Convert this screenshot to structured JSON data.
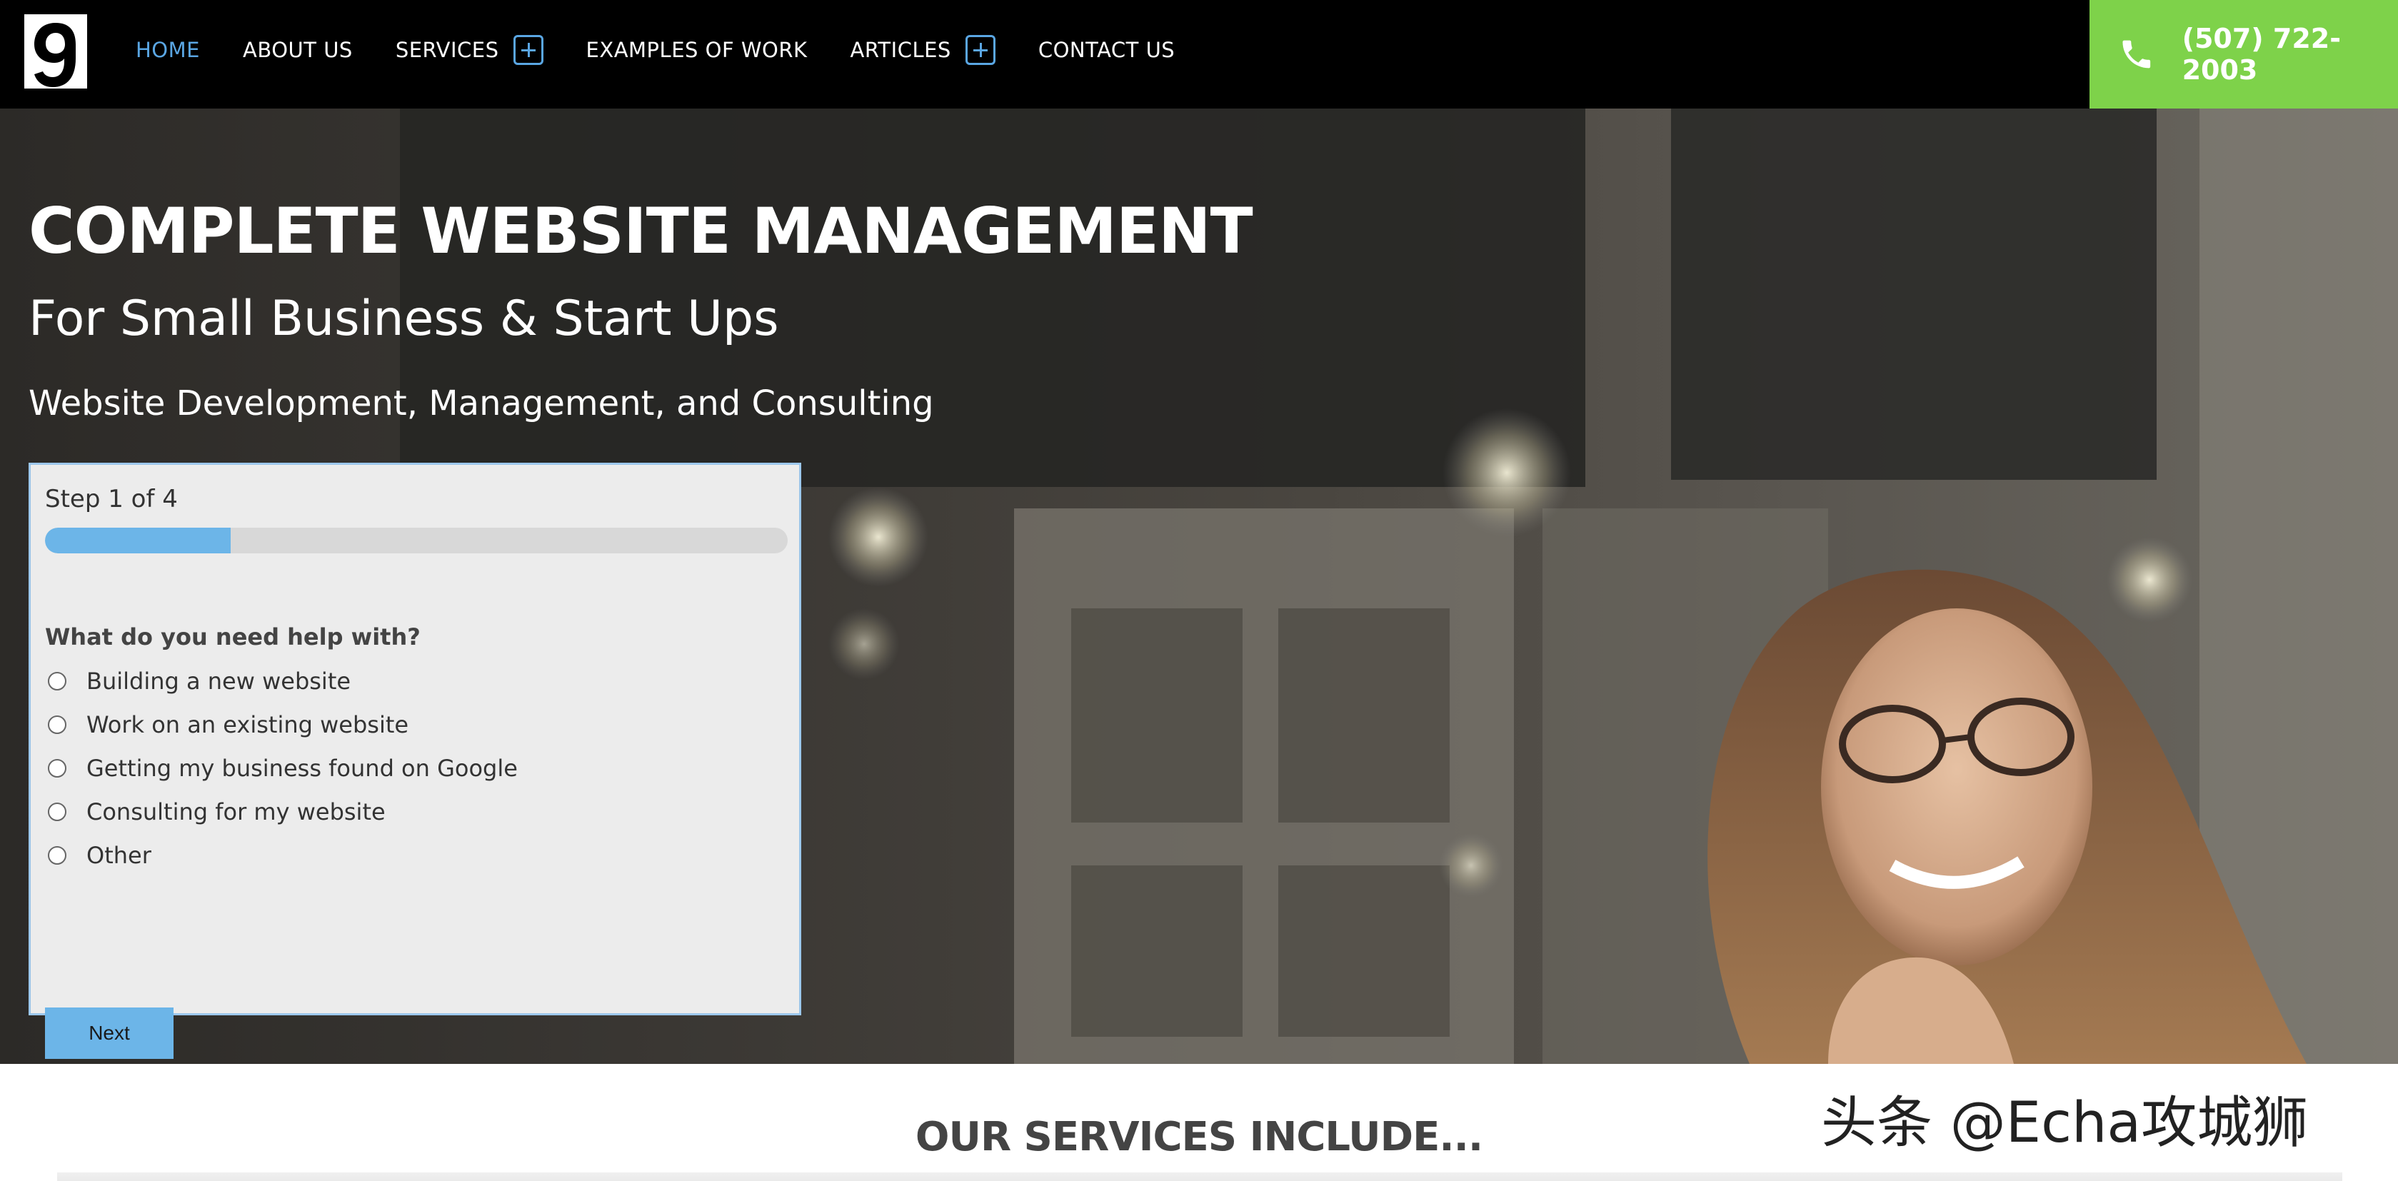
{
  "brand": {
    "logo_icon": "nine-logo-icon"
  },
  "nav": {
    "items": [
      {
        "label": "HOME",
        "active": true,
        "has_submenu": false
      },
      {
        "label": "ABOUT US",
        "active": false,
        "has_submenu": false
      },
      {
        "label": "SERVICES",
        "active": false,
        "has_submenu": true
      },
      {
        "label": "EXAMPLES OF WORK",
        "active": false,
        "has_submenu": false
      },
      {
        "label": "ARTICLES",
        "active": false,
        "has_submenu": true
      },
      {
        "label": "CONTACT US",
        "active": false,
        "has_submenu": false
      }
    ],
    "phone": "(507) 722-2003",
    "phone_icon": "phone-icon"
  },
  "hero": {
    "title": "COMPLETE WEBSITE MANAGEMENT",
    "subtitle": "For Small Business & Start Ups",
    "tagline": "Website Development, Management, and Consulting"
  },
  "form": {
    "step": "Step 1 of 4",
    "progress": 0.25,
    "question": "What do you need help with?",
    "options": [
      "Building a new website",
      "Work on an existing website",
      "Getting my business found on Google",
      "Consulting for my website",
      "Other"
    ],
    "next_label": "Next"
  },
  "section": {
    "title": "OUR SERVICES INCLUDE..."
  },
  "watermark": "头条 @Echa攻城狮",
  "colors": {
    "accent": "#5aa6e3",
    "phone_bg": "#7ed24a",
    "nav_bg": "#000000",
    "progress": "#6cb5e8"
  }
}
